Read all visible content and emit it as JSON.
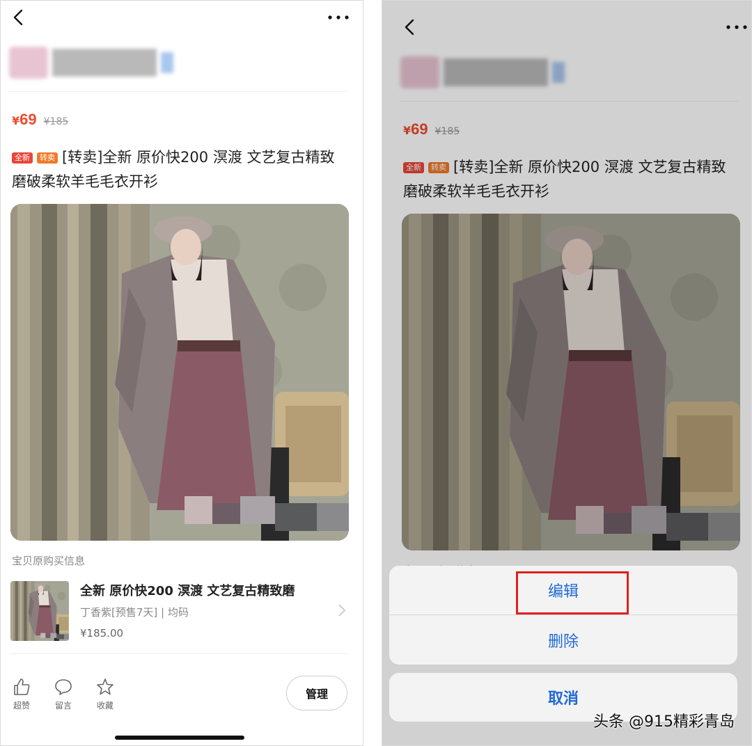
{
  "listing": {
    "price_symbol": "¥",
    "price": "69",
    "original_price": "¥185",
    "tags": {
      "new": "全新",
      "resell": "转卖"
    },
    "title": "[转卖]全新 原价快200 溟渡 文艺复古精致磨破柔软羊毛毛衣开衫"
  },
  "purchase_info": {
    "label": "宝贝原购买信息",
    "title": "全新 原价快200 溟渡 文艺复古精致磨",
    "spec": "丁香紫[预售7天] | 均码",
    "price": "¥185.00"
  },
  "actions": {
    "like": "超赞",
    "comment": "留言",
    "favorite": "收藏",
    "manage": "管理"
  },
  "action_sheet": {
    "edit": "编辑",
    "delete": "删除",
    "cancel": "取消"
  },
  "watermark": "头条 @915精彩青岛",
  "colors": {
    "price_red": "#ee4b2e",
    "sheet_blue": "#1f6ad6",
    "highlight_red": "#e11e1e",
    "tag_new": "#e8463a",
    "tag_resell": "#f07a2a"
  }
}
